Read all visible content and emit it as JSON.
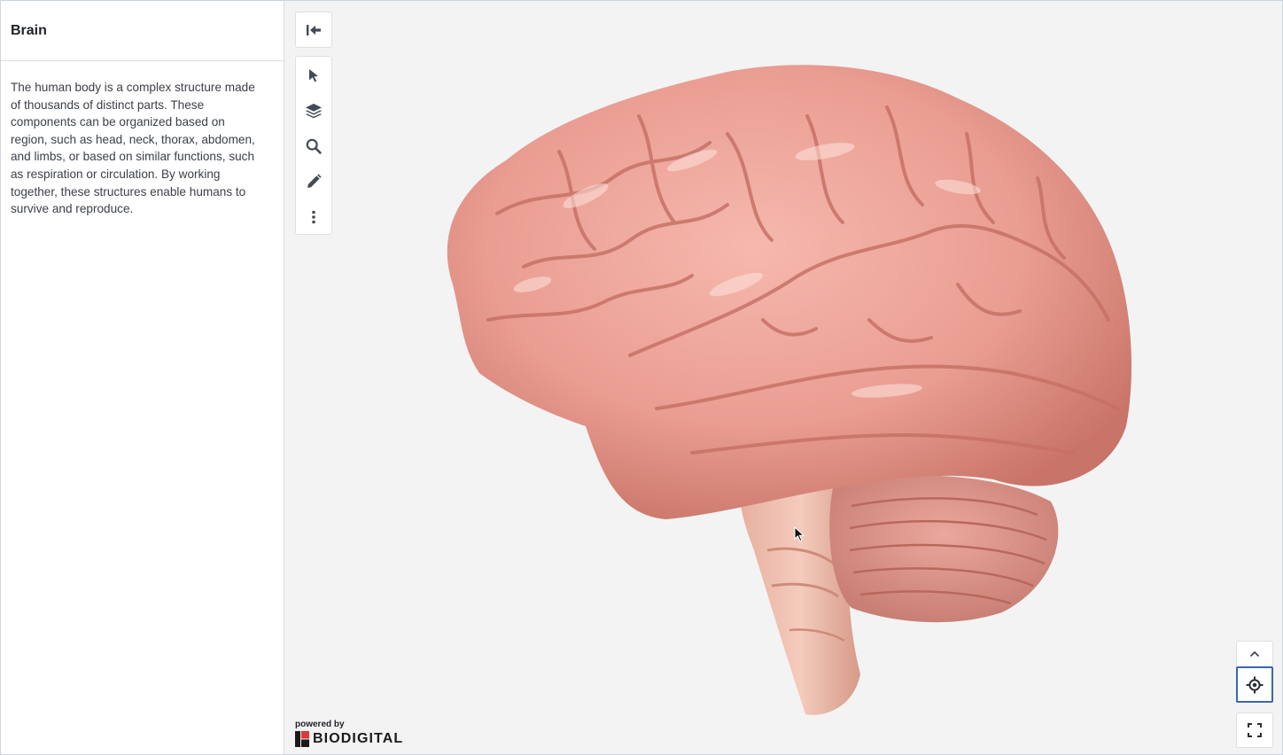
{
  "sidebar": {
    "title": "Brain",
    "description": "The human body is a complex structure made of thousands of distinct parts. These components can be organized based on region, such as head, neck, thorax, abdomen, and limbs, or based on similar functions, such as respiration or circulation. By working together, these structures enable humans to survive and reproduce."
  },
  "toolbar": {
    "collapse_icon": "collapse-panel-icon",
    "items": [
      {
        "icon": "select-icon"
      },
      {
        "icon": "layers-icon"
      },
      {
        "icon": "search-icon"
      },
      {
        "icon": "draw-icon"
      },
      {
        "icon": "more-options-icon"
      }
    ]
  },
  "branding": {
    "powered_by": "powered by",
    "brand": "BIODIGITAL"
  },
  "colors": {
    "accent": "#3a66b3",
    "brain": "#e89a8e",
    "background": "#f3f3f4"
  }
}
